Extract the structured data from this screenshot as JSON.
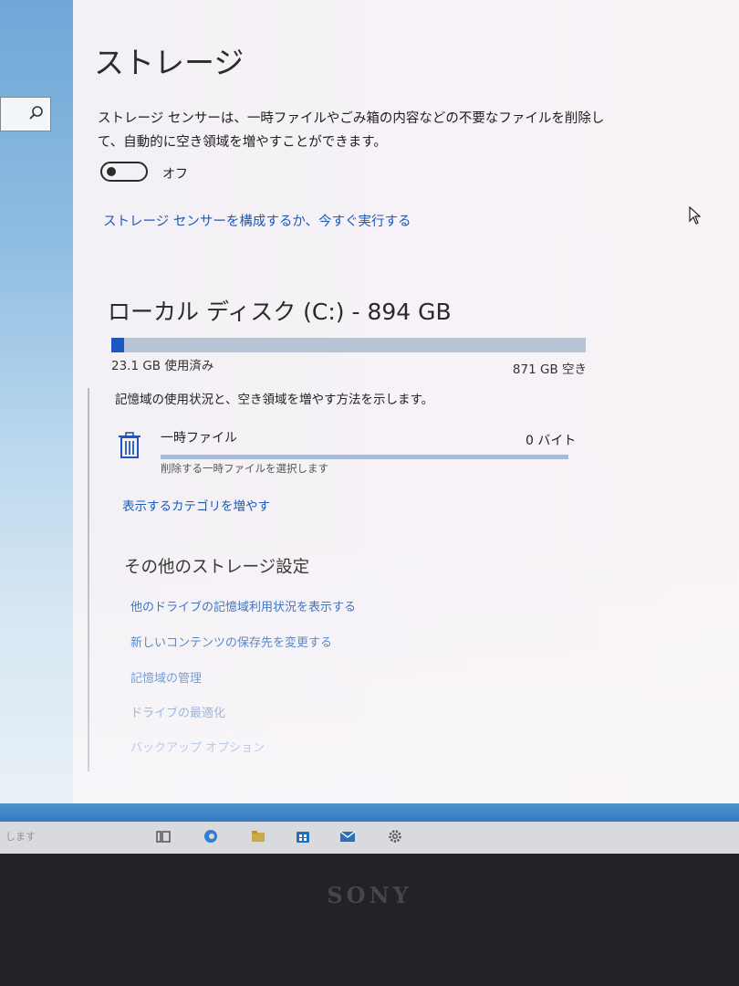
{
  "page_title": "ストレージ",
  "storage_sense": {
    "description": "ストレージ センサーは、一時ファイルやごみ箱の内容などの不要なファイルを削除して、自動的に空き領域を増やすことができます。",
    "toggle_state": "オフ",
    "configure_link": "ストレージ センサーを構成するか、今すぐ実行する"
  },
  "disk": {
    "title": "ローカル ディスク (C:) - 894 GB",
    "used_label": "23.1 GB 使用済み",
    "free_label": "871 GB 空き",
    "used_fraction": 0.026,
    "usage_description": "記憶域の使用状況と、空き領域を増やす方法を示します。"
  },
  "categories": [
    {
      "icon": "trash-icon",
      "name": "一時ファイル",
      "size": "0 バイト",
      "description": "削除する一時ファイルを選択します",
      "fill_fraction": 0
    }
  ],
  "show_more_categories": "表示するカテゴリを増やす",
  "other_settings": {
    "heading": "その他のストレージ設定",
    "links": [
      "他のドライブの記憶域利用状況を表示する",
      "新しいコンテンツの保存先を変更する",
      "記憶域の管理",
      "ドライブの最適化",
      "バックアップ オプション"
    ]
  },
  "taskbar": {
    "search_text": "します",
    "icons": [
      "task-view-icon",
      "edge-icon",
      "file-explorer-icon",
      "store-icon",
      "mail-icon",
      "settings-icon"
    ]
  },
  "bezel_brand": "SONY",
  "colors": {
    "accent": "#1d56c0",
    "link": "#1a5bb8",
    "bar_track": "#b8c3d6"
  }
}
